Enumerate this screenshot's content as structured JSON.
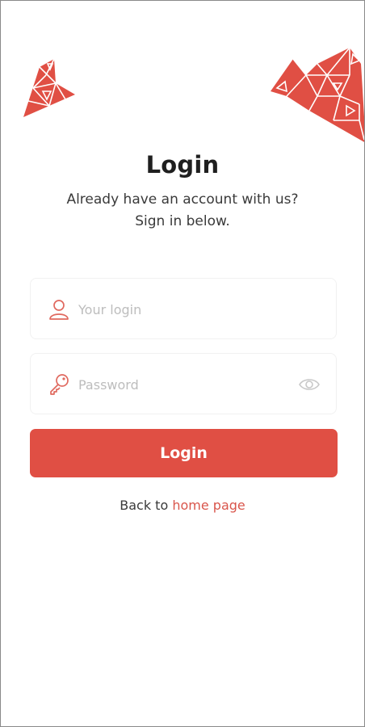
{
  "header": {
    "title": "Login",
    "subtitle_line1": "Already have an account with us?",
    "subtitle_line2": "Sign in below."
  },
  "form": {
    "login": {
      "placeholder": "Your login",
      "value": "",
      "icon": "user-icon"
    },
    "password": {
      "placeholder": "Password",
      "value": "",
      "icon": "key-icon",
      "toggle_icon": "eye-icon"
    },
    "submit_label": "Login"
  },
  "footer": {
    "back_prefix": "Back to",
    "back_link": "home page"
  },
  "colors": {
    "accent": "#e04f44",
    "link": "#d9564c",
    "field_border": "#f1f1f1",
    "placeholder": "#bdbdbd"
  }
}
